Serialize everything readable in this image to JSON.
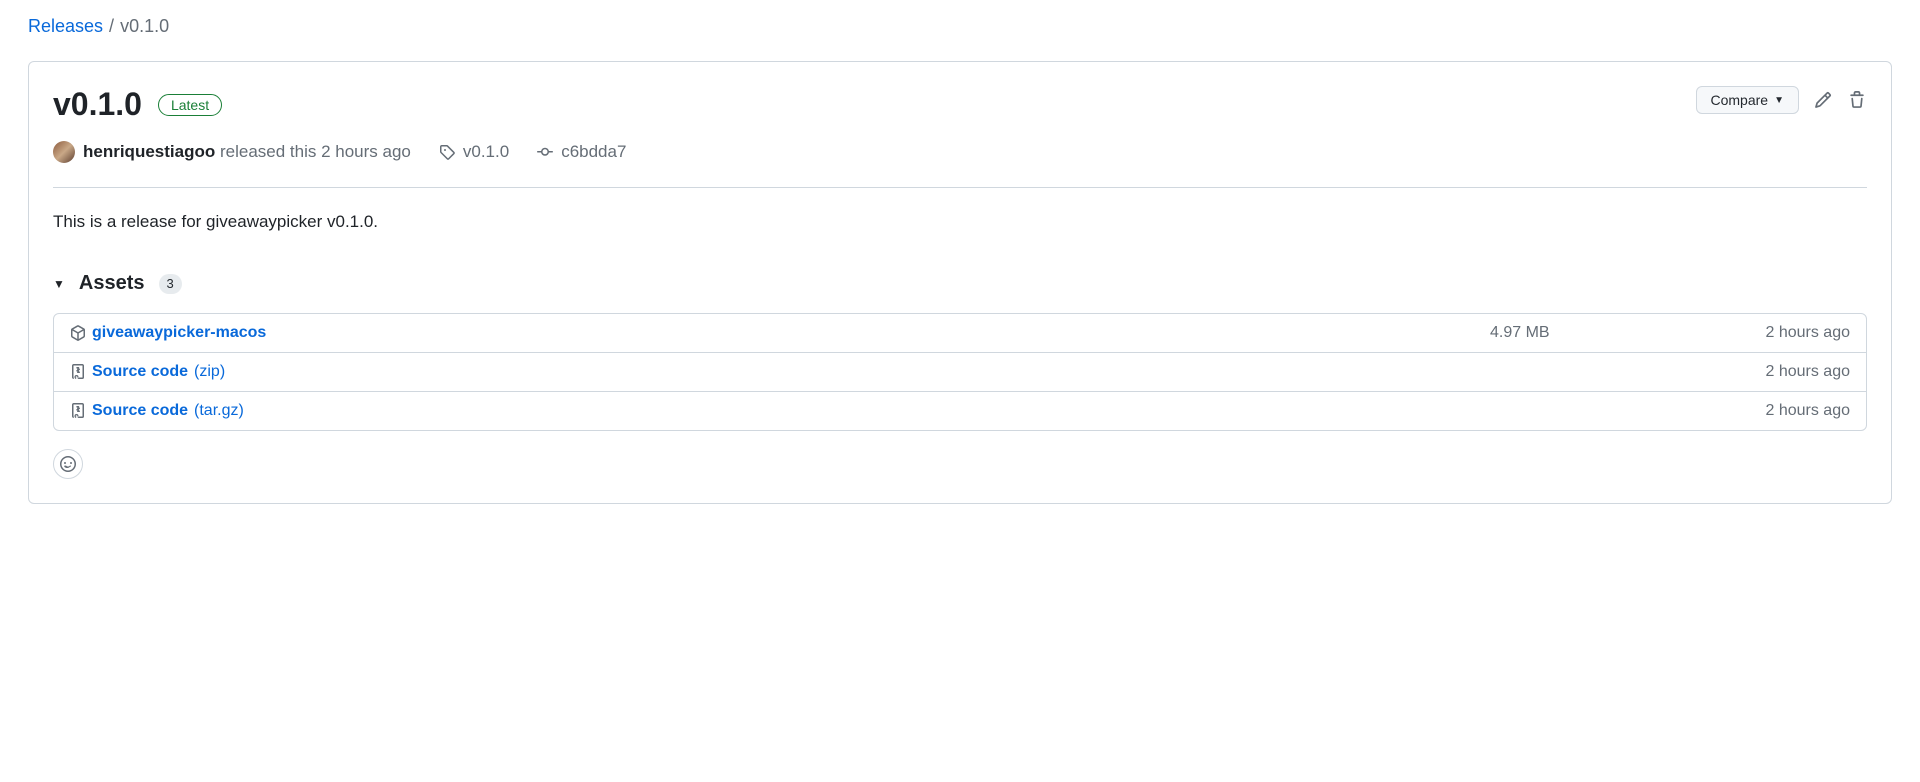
{
  "breadcrumb": {
    "root": "Releases",
    "current": "v0.1.0"
  },
  "release": {
    "title": "v0.1.0",
    "latest_label": "Latest",
    "compare_label": "Compare",
    "author": "henriquestiagoo",
    "released_text": "released this 2 hours ago",
    "tag": "v0.1.0",
    "commit": "c6bdda7",
    "body": "This is a release for giveawaypicker v0.1.0."
  },
  "assets": {
    "heading": "Assets",
    "count": "3",
    "items": [
      {
        "name": "giveawaypicker-macos",
        "format": "",
        "size": "4.97 MB",
        "time": "2 hours ago",
        "icon": "package"
      },
      {
        "name": "Source code",
        "format": "(zip)",
        "size": "",
        "time": "2 hours ago",
        "icon": "zip"
      },
      {
        "name": "Source code",
        "format": "(tar.gz)",
        "size": "",
        "time": "2 hours ago",
        "icon": "zip"
      }
    ]
  }
}
